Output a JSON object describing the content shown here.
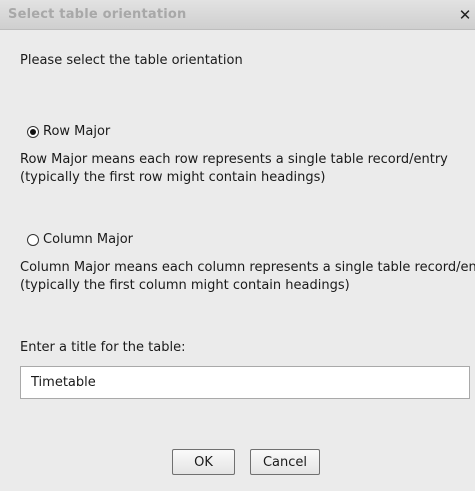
{
  "dialog": {
    "title": "Select table orientation",
    "close_glyph": "✕",
    "prompt": "Please select the table orientation",
    "options": [
      {
        "label": "Row Major",
        "selected": true,
        "description_line1": "Row Major means each row represents a single table record/entry",
        "description_line2": "(typically the first row might contain headings)"
      },
      {
        "label": "Column Major",
        "selected": false,
        "description_line1": "Column Major means each column represents a single table record/entry",
        "description_line2": "(typically the first column might contain headings)"
      }
    ],
    "title_field": {
      "label": "Enter a title for the table:",
      "value": "Timetable"
    },
    "buttons": {
      "ok_label": "OK",
      "cancel_label": "Cancel"
    }
  }
}
